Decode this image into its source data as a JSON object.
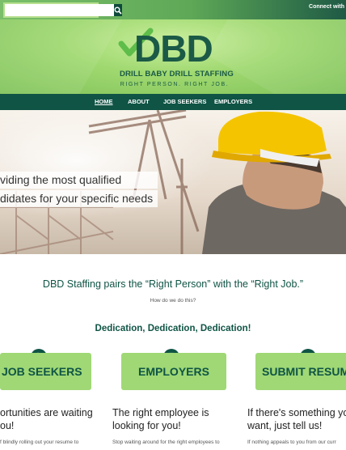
{
  "topbar": {
    "search_placeholder": "",
    "connect_text": "Connect with"
  },
  "logo": {
    "letters": "DBD",
    "name": "DRILL BABY DRILL STAFFING",
    "tagline": "RIGHT PERSON. RIGHT JOB."
  },
  "nav": {
    "items": [
      {
        "label": "HOME",
        "active": true
      },
      {
        "label": "ABOUT",
        "active": false
      },
      {
        "label": "JOB SEEKERS",
        "active": false
      },
      {
        "label": "EMPLOYERS",
        "active": false
      }
    ]
  },
  "hero": {
    "line1": "viding the most qualified",
    "line2": "didates for your specific needs"
  },
  "intro": {
    "tagline": "DBD Staffing pairs the “Right Person” with the “Right Job.”",
    "subtext": "How do we do this?",
    "dedication": "Dedication, Dedication, Dedication!"
  },
  "cards": [
    {
      "icon": "search-icon",
      "button": "JOB SEEKERS",
      "title_line1": "ortunities are waiting",
      "title_line2": "ou!",
      "body": "f blindly rolling out your resume to"
    },
    {
      "icon": "briefcase-icon",
      "button": "EMPLOYERS",
      "title_line1": "The right employee is",
      "title_line2": "looking for you!",
      "body": "Stop waiting around for the right employees to"
    },
    {
      "icon": "checkmark-icon",
      "button": "SUBMIT RESUM",
      "title_line1": "If there's something yo",
      "title_line2": "want, just tell us!",
      "body": "If nothing appeals to you from our curr"
    }
  ],
  "colors": {
    "brand_dark": "#0f5445",
    "brand_light_green": "#9fd875",
    "header_green": "#9fd86f",
    "helmet_yellow": "#f5c400"
  }
}
